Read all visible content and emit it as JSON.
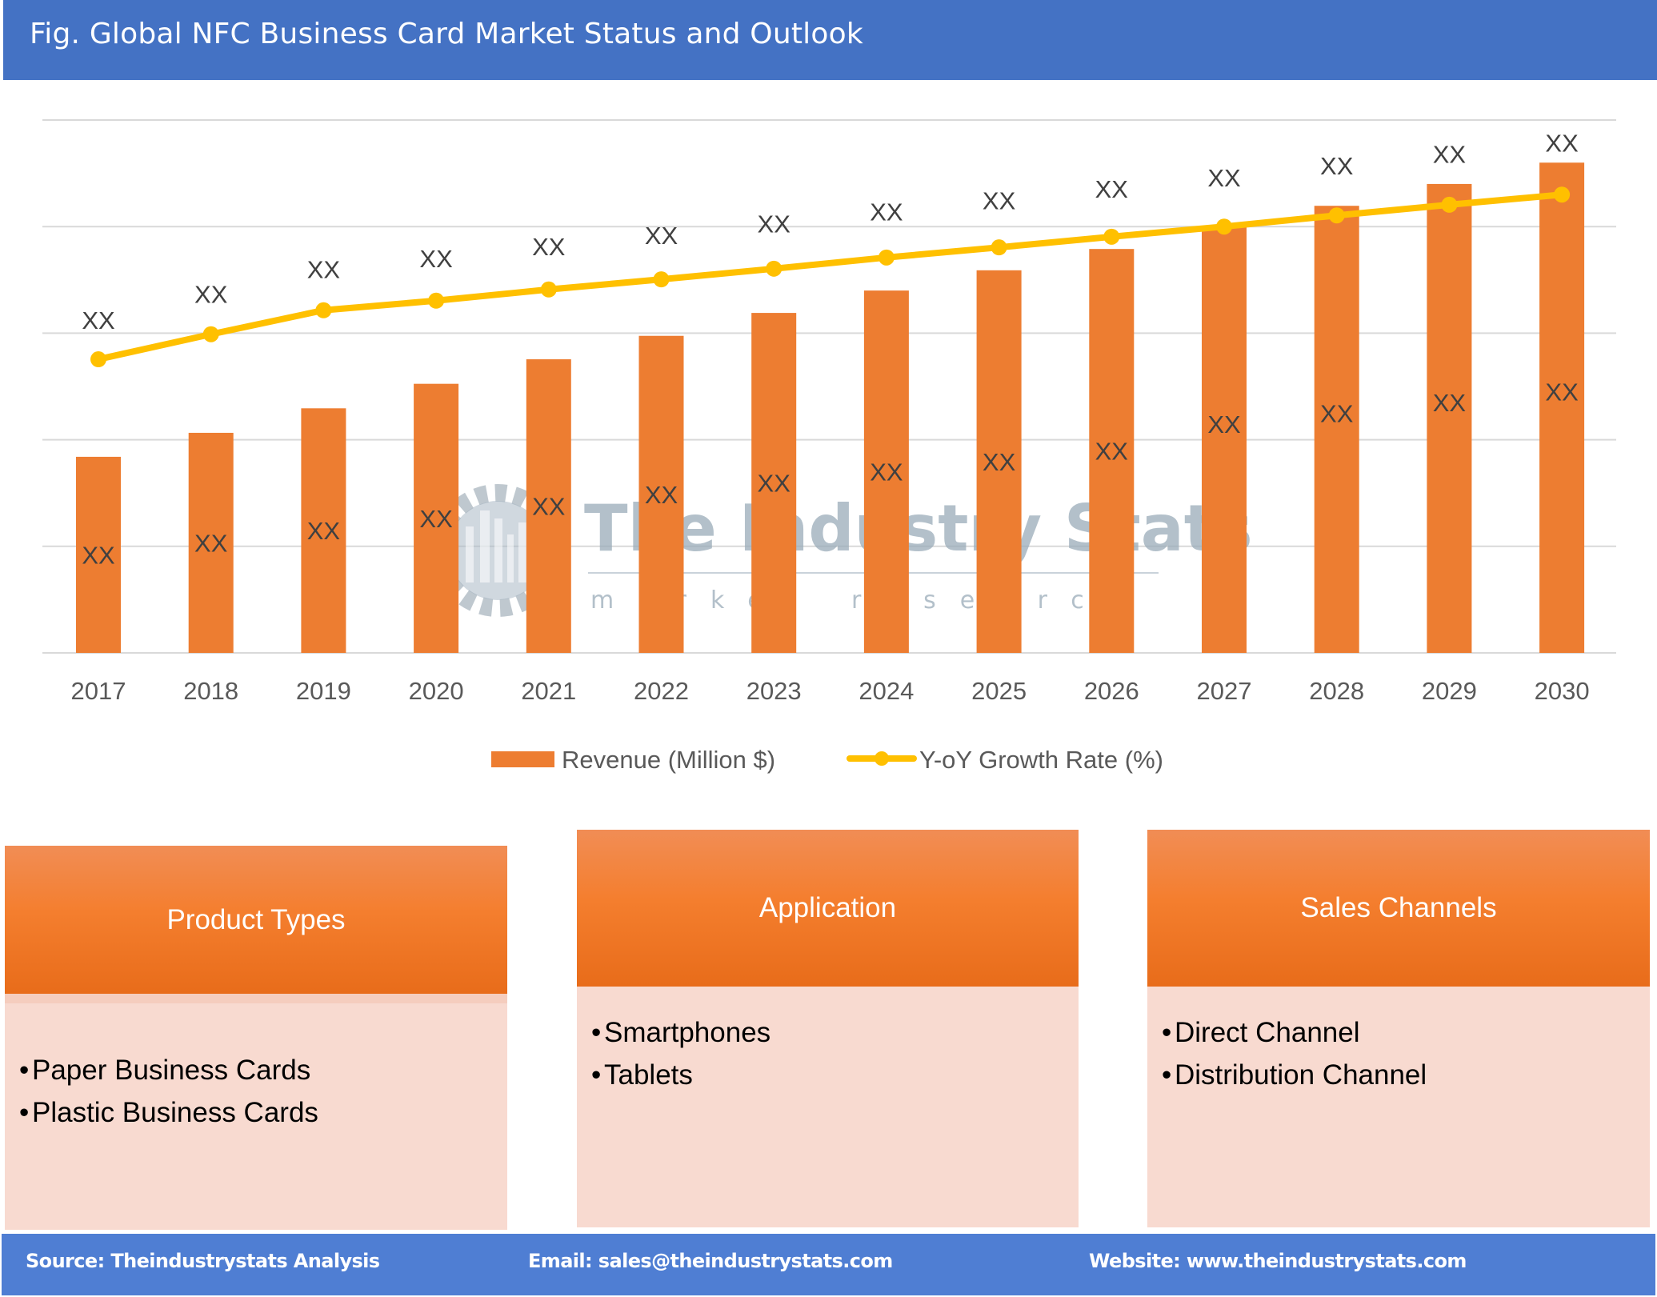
{
  "header": {
    "title": "Fig. Global NFC Business Card Market Status and Outlook"
  },
  "colors": {
    "header_bg": "#4472C4",
    "footer_bg": "#4F7ED3",
    "bar": "#ED7D31",
    "line": "#FFC000",
    "panel_head": "#F47E2E",
    "panel_body": "#F8DAD0"
  },
  "chart_data": {
    "type": "bar",
    "title": "",
    "xlabel": "",
    "ylabel": "",
    "categories": [
      "2017",
      "2018",
      "2019",
      "2020",
      "2021",
      "2022",
      "2023",
      "2024",
      "2025",
      "2026",
      "2027",
      "2028",
      "2029",
      "2030"
    ],
    "ylim": [
      0,
      100
    ],
    "y_tick_labels_shown": false,
    "grid": true,
    "gridline_values": [
      0,
      20,
      40,
      60,
      80,
      100
    ],
    "legend_position": "bottom",
    "series": [
      {
        "name": "Revenue (Million $)",
        "type": "bar",
        "color": "#ED7D31",
        "values": [
          36.8,
          41.3,
          45.9,
          50.5,
          55.1,
          59.5,
          63.8,
          68.0,
          71.8,
          75.8,
          79.9,
          83.9,
          88.0,
          92.0
        ],
        "data_labels": [
          "XX",
          "XX",
          "XX",
          "XX",
          "XX",
          "XX",
          "XX",
          "XX",
          "XX",
          "XX",
          "XX",
          "XX",
          "XX",
          "XX"
        ]
      },
      {
        "name": "Y-oY Growth Rate (%)",
        "type": "line",
        "color": "#FFC000",
        "values": [
          55.1,
          59.8,
          64.3,
          66.1,
          68.2,
          70.1,
          72.1,
          74.2,
          76.1,
          78.1,
          80.0,
          82.1,
          84.1,
          86.0
        ],
        "data_labels": [
          "XX",
          "XX",
          "XX",
          "XX",
          "XX",
          "XX",
          "XX",
          "XX",
          "XX",
          "XX",
          "XX",
          "XX",
          "XX",
          "XX"
        ]
      }
    ],
    "watermark": {
      "title": "The Industry Stats",
      "subtitle": "market research"
    }
  },
  "panels": [
    {
      "title": "Product Types",
      "items": [
        "Paper Business Cards",
        "Plastic Business Cards"
      ]
    },
    {
      "title": "Application",
      "items": [
        "Smartphones",
        "Tablets"
      ]
    },
    {
      "title": "Sales Channels",
      "items": [
        "Direct Channel",
        "Distribution Channel"
      ]
    }
  ],
  "bullet_char": "•",
  "footer": {
    "source": "Source: Theindustrystats Analysis",
    "email": "Email: sales@theindustrystats.com",
    "website": "Website: www.theindustrystats.com"
  }
}
